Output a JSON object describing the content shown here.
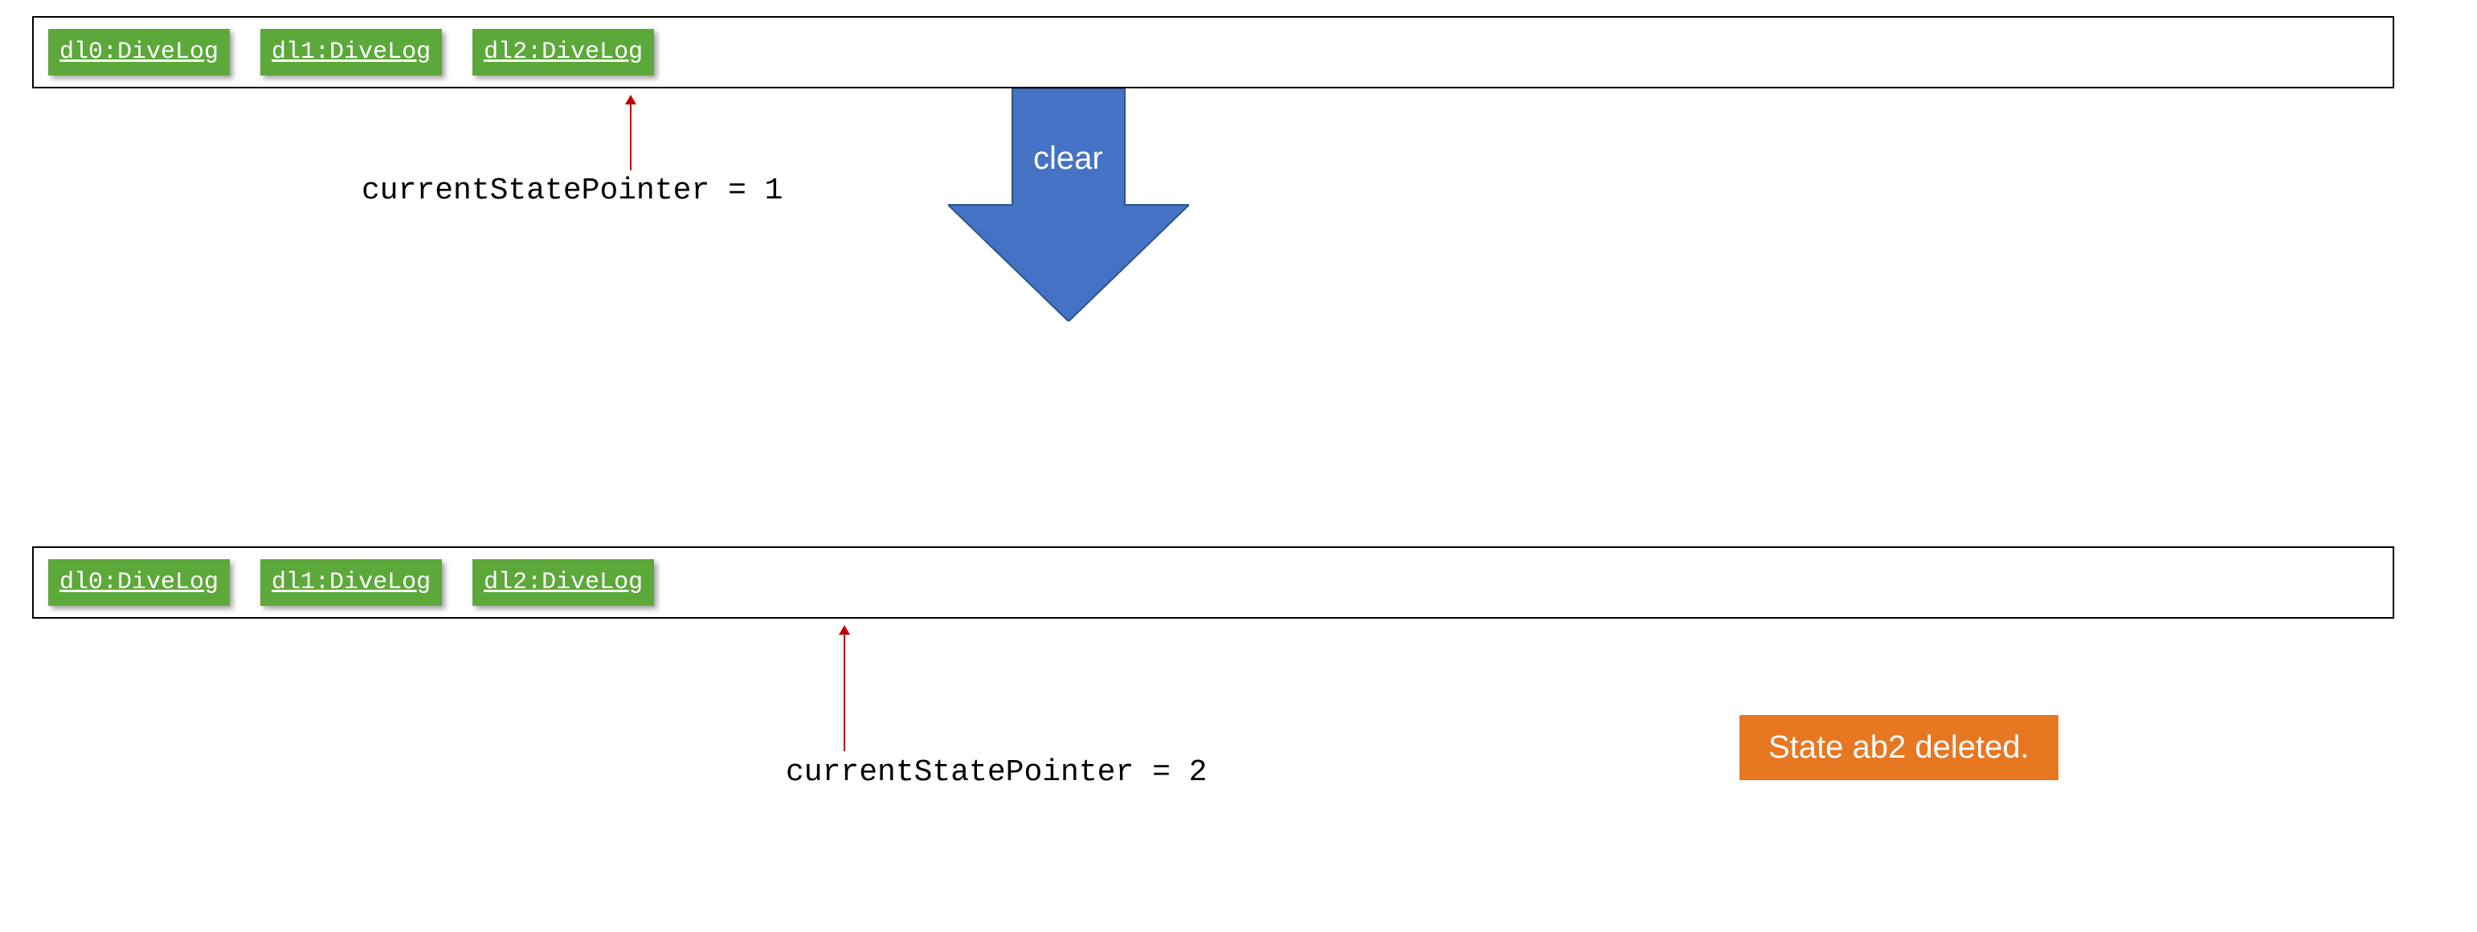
{
  "topList": {
    "items": [
      {
        "label": "dl0:DiveLog"
      },
      {
        "label": "dl1:DiveLog"
      },
      {
        "label": "dl2:DiveLog"
      }
    ]
  },
  "bottomList": {
    "items": [
      {
        "label": "dl0:DiveLog"
      },
      {
        "label": "dl1:DiveLog"
      },
      {
        "label": "dl2:DiveLog"
      }
    ]
  },
  "topPointer": {
    "label": "currentStatePointer = 1"
  },
  "bottomPointer": {
    "label": "currentStatePointer = 2"
  },
  "transitionArrow": {
    "label": "clear"
  },
  "callout": {
    "text": "State ab2 deleted."
  },
  "colors": {
    "stateBox": "#5DA83B",
    "pointerArrow": "#C00000",
    "bigArrow": "#4472C4",
    "callout": "#E87722"
  }
}
